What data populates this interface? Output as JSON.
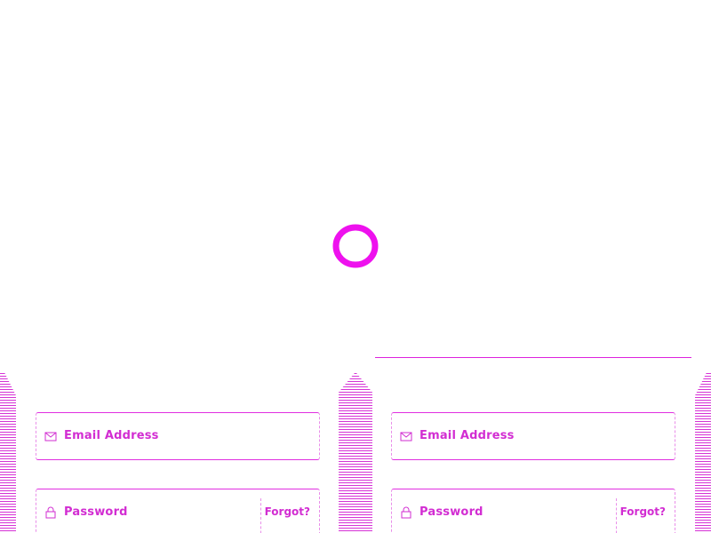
{
  "colors": {
    "accent": "#e020e0",
    "line": "#d633d6",
    "background": "#ffffff"
  },
  "loading": {
    "icon": "loading-ring-icon"
  },
  "forms": [
    {
      "email": {
        "label": "Email Address",
        "icon": "envelope-icon"
      },
      "password": {
        "label": "Password",
        "icon": "lock-icon"
      },
      "forgot_label": "Forgot?"
    },
    {
      "email": {
        "label": "Email Address",
        "icon": "envelope-icon"
      },
      "password": {
        "label": "Password",
        "icon": "lock-icon"
      },
      "forgot_label": "Forgot?"
    }
  ]
}
